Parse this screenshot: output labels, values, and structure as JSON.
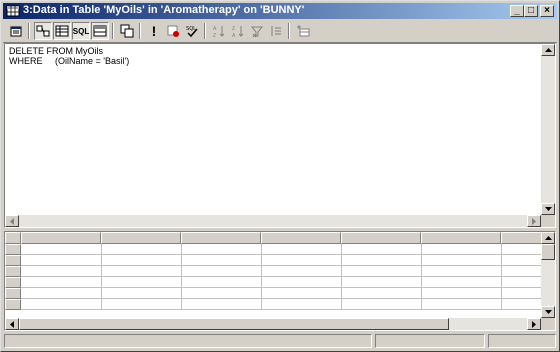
{
  "window": {
    "title": "3:Data in Table 'MyOils' in 'Aromatherapy' on 'BUNNY'",
    "controls": [
      "_",
      "□",
      "×"
    ]
  },
  "toolbar": {
    "buttons": [
      {
        "icon": "properties-icon",
        "glyph": "🗂"
      },
      {
        "icon": "diagram-pane-icon",
        "glyph": "▦"
      },
      {
        "icon": "grid-pane-icon",
        "glyph": "▤"
      },
      {
        "icon": "sql-pane-icon",
        "glyph": "SQL"
      },
      {
        "icon": "results-pane-icon",
        "glyph": "▥"
      },
      {
        "icon": "change-type-icon",
        "glyph": "⧉"
      },
      {
        "icon": "run-icon",
        "glyph": "!"
      },
      {
        "icon": "stop-icon",
        "glyph": "⊘"
      },
      {
        "icon": "verify-sql-icon",
        "glyph": "✓"
      },
      {
        "icon": "sort-ascending-icon",
        "glyph": "↓"
      },
      {
        "icon": "sort-descending-icon",
        "glyph": "↑"
      },
      {
        "icon": "remove-filter-icon",
        "glyph": "✗"
      },
      {
        "icon": "use-group-by-icon",
        "glyph": "⁝"
      },
      {
        "icon": "add-table-icon",
        "glyph": "⊞"
      }
    ]
  },
  "sql": {
    "line1": "DELETE FROM MyOils",
    "line2": "WHERE     (OilName = 'Basil')"
  },
  "colors": {
    "titlebar_start": "#0a246a",
    "titlebar_end": "#a6caf0",
    "face": "#d4d0c8"
  }
}
